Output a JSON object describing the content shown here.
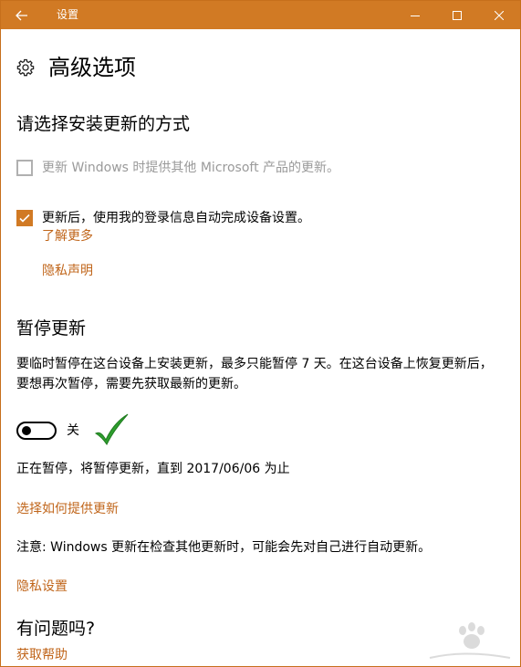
{
  "window": {
    "title": "设置"
  },
  "page": {
    "title": "高级选项"
  },
  "install_section": {
    "title": "请选择安装更新的方式",
    "option_other_products": {
      "label": "更新 Windows 时提供其他 Microsoft 产品的更新。",
      "checked": false,
      "enabled": false
    },
    "option_auto_signin": {
      "label": "更新后，使用我的登录信息自动完成设备设置。",
      "checked": true
    },
    "learn_more_link": "了解更多",
    "privacy_statement_link": "隐私声明"
  },
  "pause_section": {
    "title": "暂停更新",
    "description": "要临时暂停在这台设备上安装更新，最多只能暂停 7 天。在这台设备上恢复更新后，要想再次暂停，需要先获取最新的更新。",
    "toggle_state": "关",
    "toggle_on": false,
    "status": "正在暂停，将暂停更新，直到 2017/06/06 为止"
  },
  "delivery_link": "选择如何提供更新",
  "note": "注意: Windows 更新在检查其他更新时，可能会先对自己进行自动更新。",
  "privacy_settings_link": "隐私设置",
  "help_section": {
    "title": "有问题吗?",
    "get_help_link": "获取帮助"
  },
  "colors": {
    "accent": "#d17a24",
    "link": "#c0651a",
    "annotation_check": "#2e9e2e"
  }
}
